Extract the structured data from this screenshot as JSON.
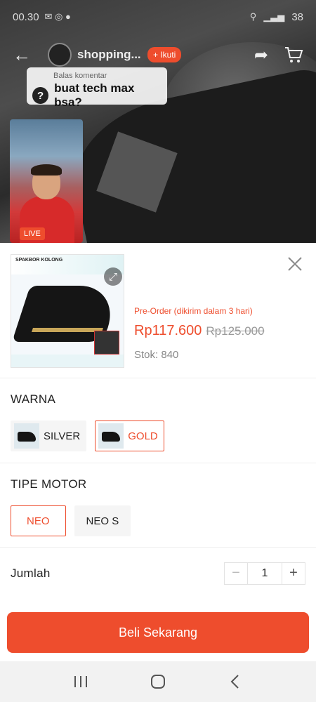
{
  "status_bar": {
    "time": "00.30",
    "battery": "38"
  },
  "live_header": {
    "shop_name": "shopping...",
    "follow_label": "+ Ikuti"
  },
  "comment": {
    "title": "Balas komentar",
    "text": "buat tech max bsa?",
    "icon": "question-icon"
  },
  "pip": {
    "badge": "LIVE"
  },
  "product": {
    "preorder": "Pre-Order (dikirim dalam 3 hari)",
    "price": "Rp117.600",
    "old_price": "Rp125.000",
    "stock": "Stok: 840",
    "image_banner": "SPAKBOR KOLONG"
  },
  "variants": {
    "color_title": "WARNA",
    "colors": [
      {
        "label": "SILVER",
        "selected": false
      },
      {
        "label": "GOLD",
        "selected": true
      }
    ],
    "type_title": "TIPE MOTOR",
    "types": [
      {
        "label": "NEO",
        "selected": true
      },
      {
        "label": "NEO S",
        "selected": false
      }
    ]
  },
  "quantity": {
    "label": "Jumlah",
    "value": "1"
  },
  "buy_button": "Beli Sekarang",
  "accent_color": "#ee4d2d"
}
